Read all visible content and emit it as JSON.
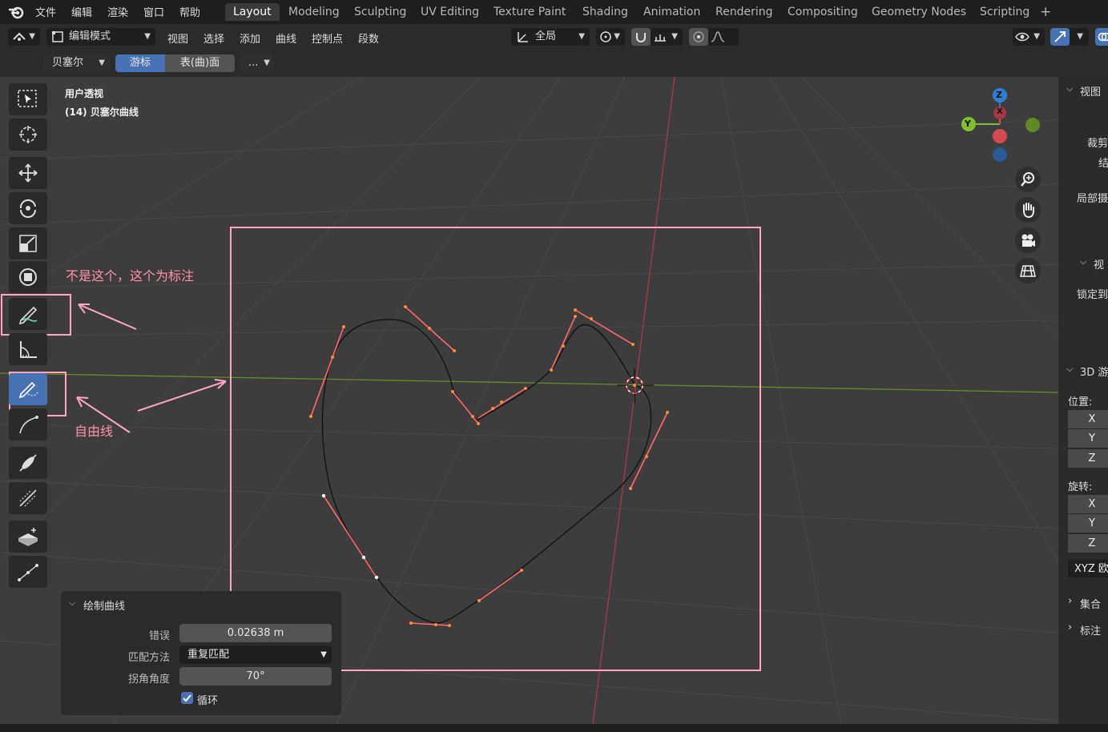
{
  "menubar": {
    "items": [
      "文件",
      "编辑",
      "渲染",
      "窗口",
      "帮助"
    ],
    "workspaces": [
      "Layout",
      "Modeling",
      "Sculpting",
      "UV Editing",
      "Texture Paint",
      "Shading",
      "Animation",
      "Rendering",
      "Compositing",
      "Geometry Nodes",
      "Scripting"
    ],
    "active_workspace": "Layout",
    "add_tab": "+"
  },
  "header": {
    "mode": "编辑模式",
    "menus": [
      "视图",
      "选择",
      "添加",
      "曲线",
      "控制点",
      "段数"
    ],
    "transform_orientation": "全局"
  },
  "header2": {
    "curve_type": "贝塞尔",
    "seg_cursor": "游标",
    "seg_surface": "表(曲)面",
    "more": "..."
  },
  "viewport": {
    "view_name": "用户透视",
    "object_name": "(14) 贝塞尔曲线",
    "gizmo": {
      "z": "Z",
      "y": "Y",
      "x": "X"
    }
  },
  "annotations": {
    "not_this": "不是这个，这个为标注",
    "freehand": "自由线"
  },
  "operator_panel": {
    "title": "绘制曲线",
    "error_label": "错误",
    "error_value": "0.02638 m",
    "fit_label": "匹配方法",
    "fit_value": "重复匹配",
    "corner_label": "拐角角度",
    "corner_value": "70°",
    "cyclic_label": "循环",
    "cyclic_checked": true
  },
  "npanel": {
    "view_section": "视图",
    "clip": "裁剪",
    "clip2": "结",
    "local_camera": "局部摄",
    "view_lock_section": "视",
    "lock_to": "锁定到",
    "cursor_section": "3D 游",
    "location": "位置:",
    "loc_x": "X",
    "loc_y": "Y",
    "loc_z": "Z",
    "rotation": "旋转:",
    "rot_x": "X",
    "rot_y": "Y",
    "rot_z": "Z",
    "rot_mode": "XYZ 欧",
    "collection": "集合",
    "annotation": "标注"
  },
  "colors": {
    "accent": "#4772b3",
    "annotation_pink": "#ffa6c0",
    "handle_orange": "#ff8a3c",
    "handle_line": "#ff6a6a",
    "axis_x": "#a53a45",
    "axis_y": "#6a8a2a"
  }
}
